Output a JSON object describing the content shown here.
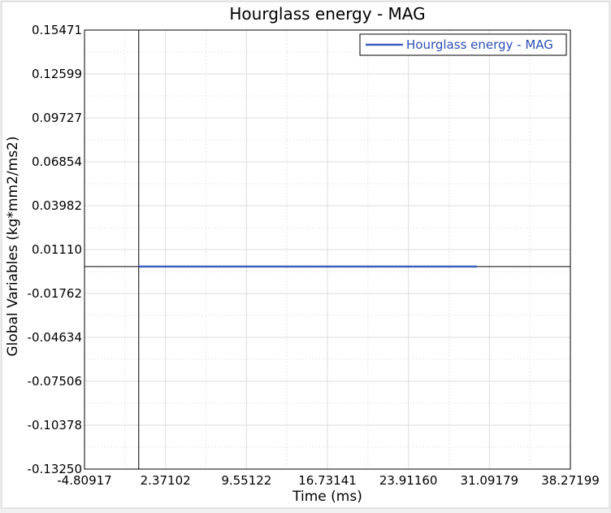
{
  "chart_data": {
    "type": "line",
    "title": "Hourglass energy - MAG",
    "xlabel": "Time (ms)",
    "ylabel": "Global Variables (kg*mm2/ms2)",
    "xlim": [
      -4.80917,
      38.27199
    ],
    "ylim": [
      -0.1325,
      0.15471
    ],
    "x_ticks": [
      -4.80917,
      2.37102,
      9.55122,
      16.73141,
      23.9116,
      31.09179,
      38.27199
    ],
    "x_tick_labels": [
      "-4.80917",
      "2.37102",
      "9.55122",
      "16.73141",
      "23.91160",
      "31.09179",
      "38.27199"
    ],
    "y_ticks": [
      0.15471,
      0.12599,
      0.09727,
      0.06854,
      0.03982,
      0.0111,
      -0.01762,
      -0.04634,
      -0.07506,
      -0.10378,
      -0.1325
    ],
    "y_tick_labels": [
      "0.15471",
      "0.12599",
      "0.09727",
      "0.06854",
      "0.03982",
      "0.01110",
      "-0.01762",
      "-0.04634",
      "-0.07506",
      "-0.10378",
      "-0.13250"
    ],
    "grid": true,
    "legend_position": "top-right",
    "series": [
      {
        "name": "Hourglass energy - MAG",
        "color": "#3f5fbf",
        "x": [
          0,
          30
        ],
        "y": [
          0,
          0
        ]
      }
    ]
  }
}
